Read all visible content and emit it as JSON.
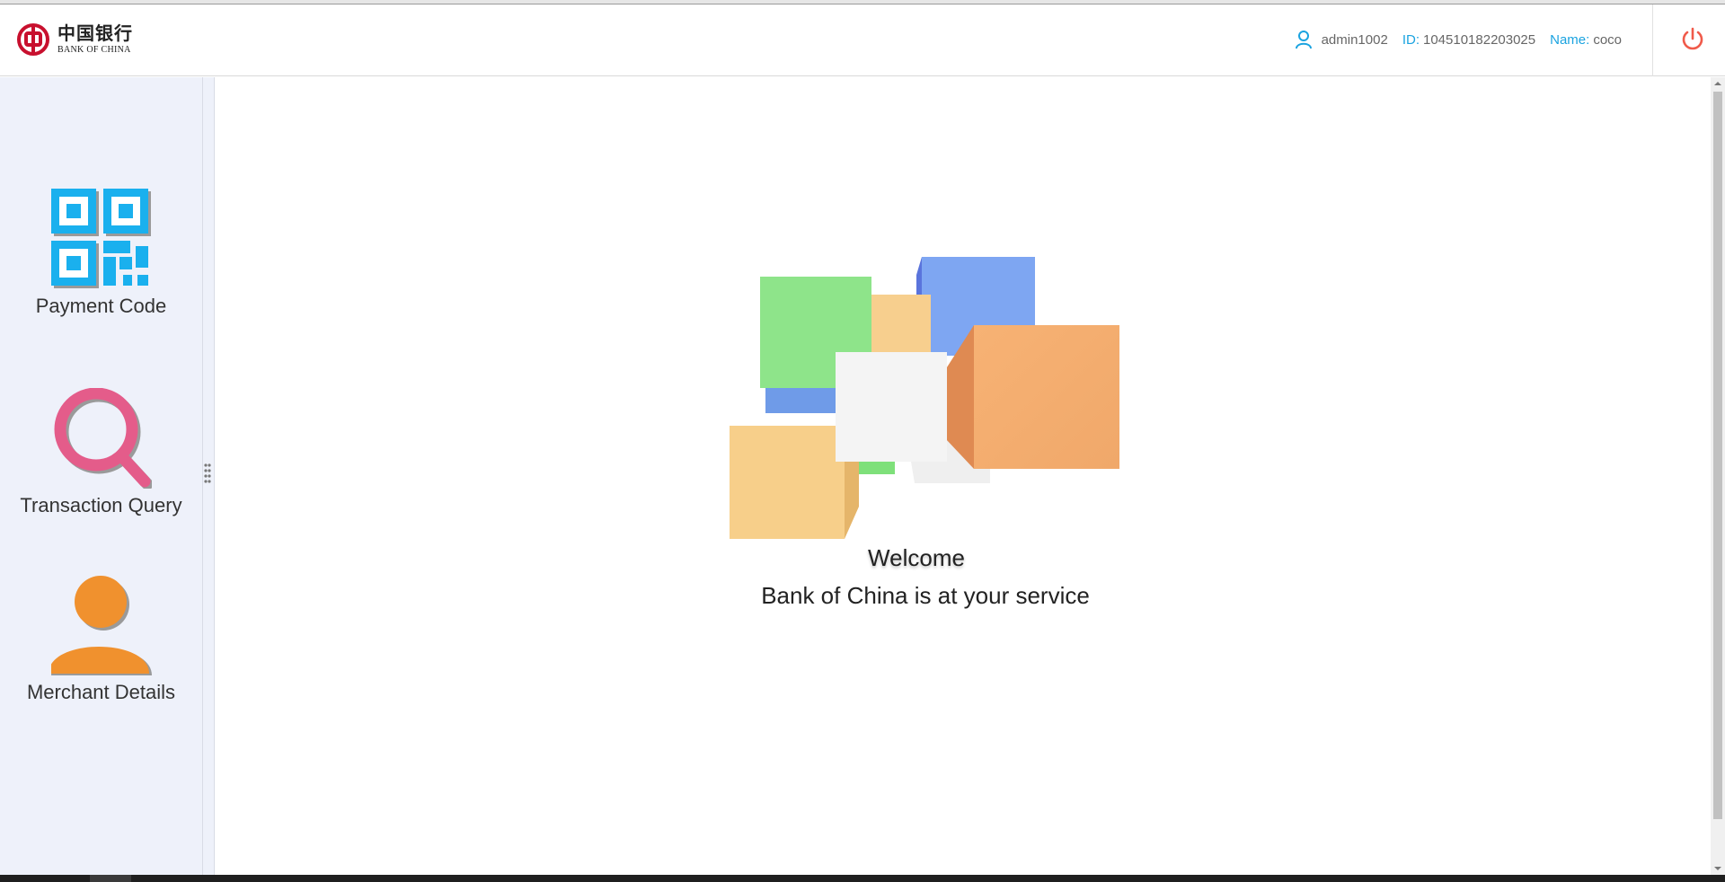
{
  "header": {
    "logo_cn": "中国银行",
    "logo_en": "BANK OF CHINA",
    "username": "admin1002",
    "id_label": "ID:",
    "id_value": "104510182203025",
    "name_label": "Name:",
    "name_value": "coco",
    "accent_color": "#1aa3e0",
    "power_color": "#f05a4a",
    "brand_color": "#c8102e"
  },
  "sidebar": {
    "items": [
      {
        "label": "Payment Code",
        "icon": "qr-code-icon",
        "color": "#1ab0ee"
      },
      {
        "label": "Transaction Query",
        "icon": "search-icon",
        "color": "#e45c8a"
      },
      {
        "label": "Merchant Details",
        "icon": "user-icon",
        "color": "#f0912e"
      }
    ]
  },
  "main": {
    "welcome": "Welcome",
    "service": "Bank of China is at your service"
  }
}
